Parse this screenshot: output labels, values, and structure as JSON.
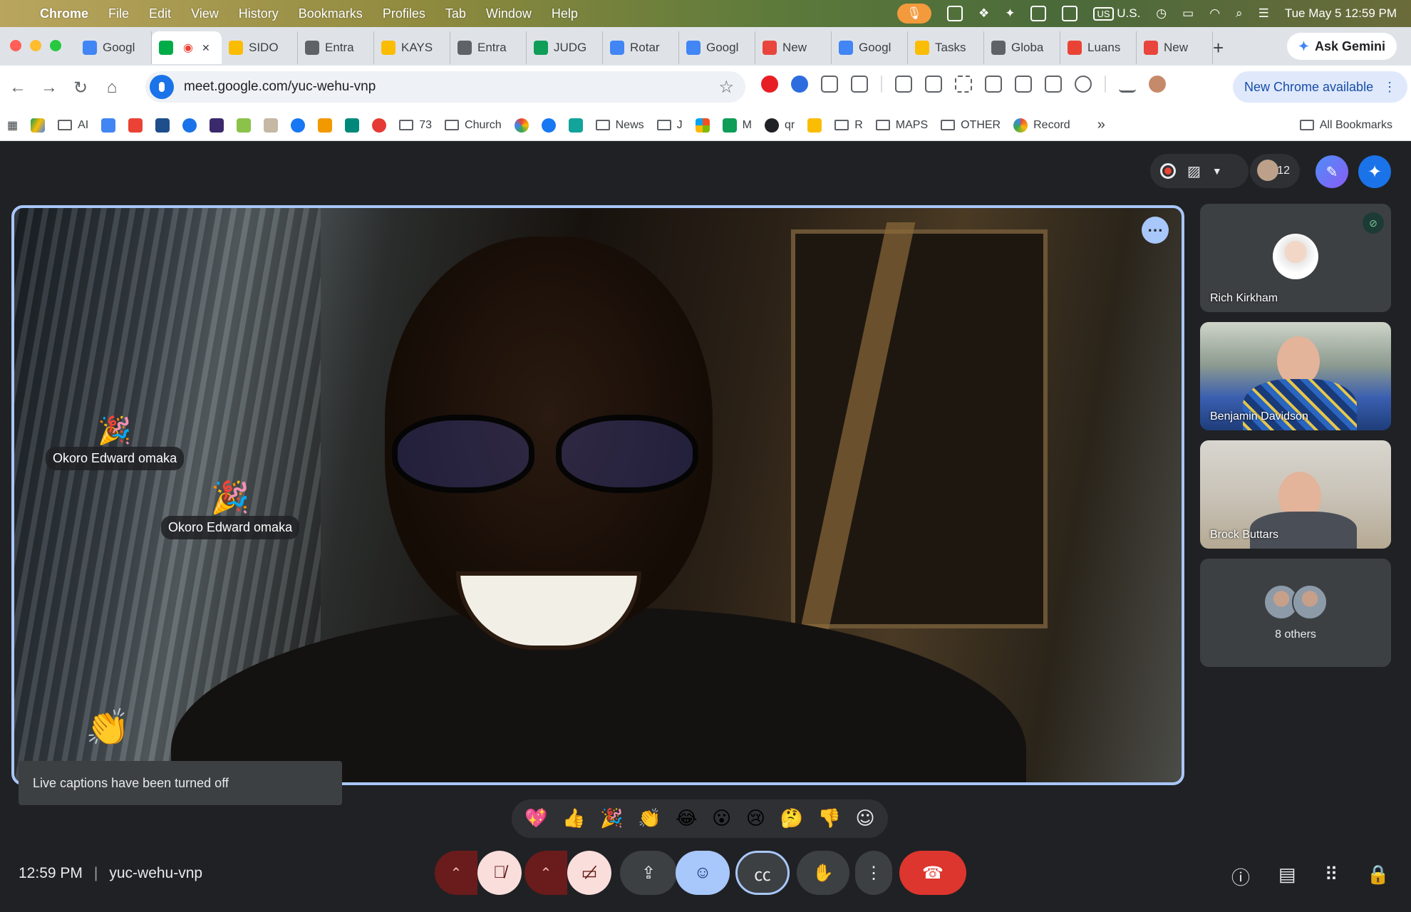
{
  "menubar": {
    "app": "Chrome",
    "items": [
      "File",
      "Edit",
      "View",
      "History",
      "Bookmarks",
      "Profiles",
      "Tab",
      "Window",
      "Help"
    ],
    "input_source": "U.S.",
    "datetime": "Tue May 5  12:59 PM"
  },
  "tabs": [
    {
      "label": "Googl",
      "color": "#4285f4"
    },
    {
      "label": "",
      "color": "#00ac47",
      "active": true
    },
    {
      "label": "SIDO",
      "color": "#fbbc04"
    },
    {
      "label": "Entra",
      "color": "#5f6368"
    },
    {
      "label": "KAYS",
      "color": "#fbbc04"
    },
    {
      "label": "Entra",
      "color": "#5f6368"
    },
    {
      "label": "JUDG",
      "color": "#0f9d58"
    },
    {
      "label": "Rotar",
      "color": "#4285f4"
    },
    {
      "label": "Googl",
      "color": "#4285f4"
    },
    {
      "label": "New",
      "color": "#e8453c"
    },
    {
      "label": "Googl",
      "color": "#4285f4"
    },
    {
      "label": "Tasks",
      "color": "#fbbc04"
    },
    {
      "label": "Globa",
      "color": "#5f6368"
    },
    {
      "label": "Luans",
      "color": "#ea4335"
    },
    {
      "label": "New",
      "color": "#e8453c"
    }
  ],
  "ask_gemini": "Ask Gemini",
  "address": {
    "url": "meet.google.com/yuc-wehu-vnp"
  },
  "new_chrome": "New Chrome available",
  "bookmarks": [
    {
      "label": "AI",
      "type": "folder"
    },
    {
      "label": "73",
      "type": "folder"
    },
    {
      "label": "Church",
      "type": "folder"
    },
    {
      "label": "News",
      "type": "folder"
    },
    {
      "label": "J",
      "type": "folder"
    },
    {
      "label": "M",
      "type": "site"
    },
    {
      "label": "qr",
      "type": "site"
    },
    {
      "label": "R",
      "type": "folder"
    },
    {
      "label": "MAPS",
      "type": "folder"
    },
    {
      "label": "OTHER",
      "type": "folder"
    },
    {
      "label": "Record",
      "type": "site"
    }
  ],
  "all_bookmarks": "All Bookmarks",
  "meet": {
    "participant_count": "12",
    "reactions": [
      {
        "emoji": "🎉",
        "name": "Okoro Edward omaka"
      },
      {
        "emoji": "🎉",
        "name": "Okoro Edward omaka"
      },
      {
        "emoji": "👏",
        "name": ""
      }
    ],
    "toast": "Live captions have been turned off",
    "participants": [
      {
        "name": "Rich Kirkham"
      },
      {
        "name": "Benjamin Davidson"
      },
      {
        "name": "Brock Buttars"
      }
    ],
    "others": "8 others",
    "emoji_bar": [
      "💖",
      "👍",
      "🎉",
      "👏",
      "😂",
      "😮",
      "😢",
      "🤔",
      "👎"
    ],
    "time": "12:59 PM",
    "meeting_code": "yuc-wehu-vnp"
  }
}
